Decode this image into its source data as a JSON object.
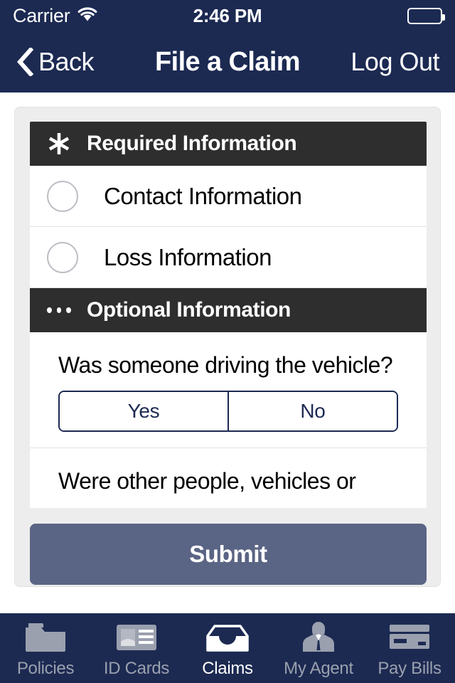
{
  "status_bar": {
    "carrier": "Carrier",
    "wifi_icon": "wifi-icon",
    "time": "2:46 PM",
    "battery_icon": "battery-full-icon"
  },
  "nav_bar": {
    "back_icon": "chevron-left-icon",
    "back_label": "Back",
    "title": "File a Claim",
    "logout_label": "Log Out"
  },
  "form": {
    "required_section": {
      "icon": "asterisk-icon",
      "title": "Required Information",
      "rows": [
        {
          "label": "Contact Information",
          "radio_icon": "radio-unchecked-icon"
        },
        {
          "label": "Loss Information",
          "radio_icon": "radio-unchecked-icon"
        }
      ]
    },
    "optional_section": {
      "icon": "ellipsis-icon",
      "title": "Optional Information",
      "questions": [
        {
          "text": "Was someone driving the vehicle?",
          "options": [
            "Yes",
            "No"
          ],
          "selected": ""
        },
        {
          "text": "Were other people, vehicles or"
        }
      ]
    },
    "submit_label": "Submit"
  },
  "tab_bar": {
    "tabs": [
      {
        "label": "Policies",
        "icon": "folder-icon",
        "active": false
      },
      {
        "label": "ID Cards",
        "icon": "id-card-icon",
        "active": false
      },
      {
        "label": "Claims",
        "icon": "inbox-tray-icon",
        "active": true
      },
      {
        "label": "My Agent",
        "icon": "agent-person-icon",
        "active": false
      },
      {
        "label": "Pay Bills",
        "icon": "credit-card-icon",
        "active": false
      }
    ]
  },
  "colors": {
    "navy": "#1c2a52",
    "section_header": "#2e2e2e",
    "panel_bg": "#ededed",
    "submit": "#5a6484",
    "tab_inactive": "#9aa0ae",
    "tab_active": "#ffffff"
  }
}
